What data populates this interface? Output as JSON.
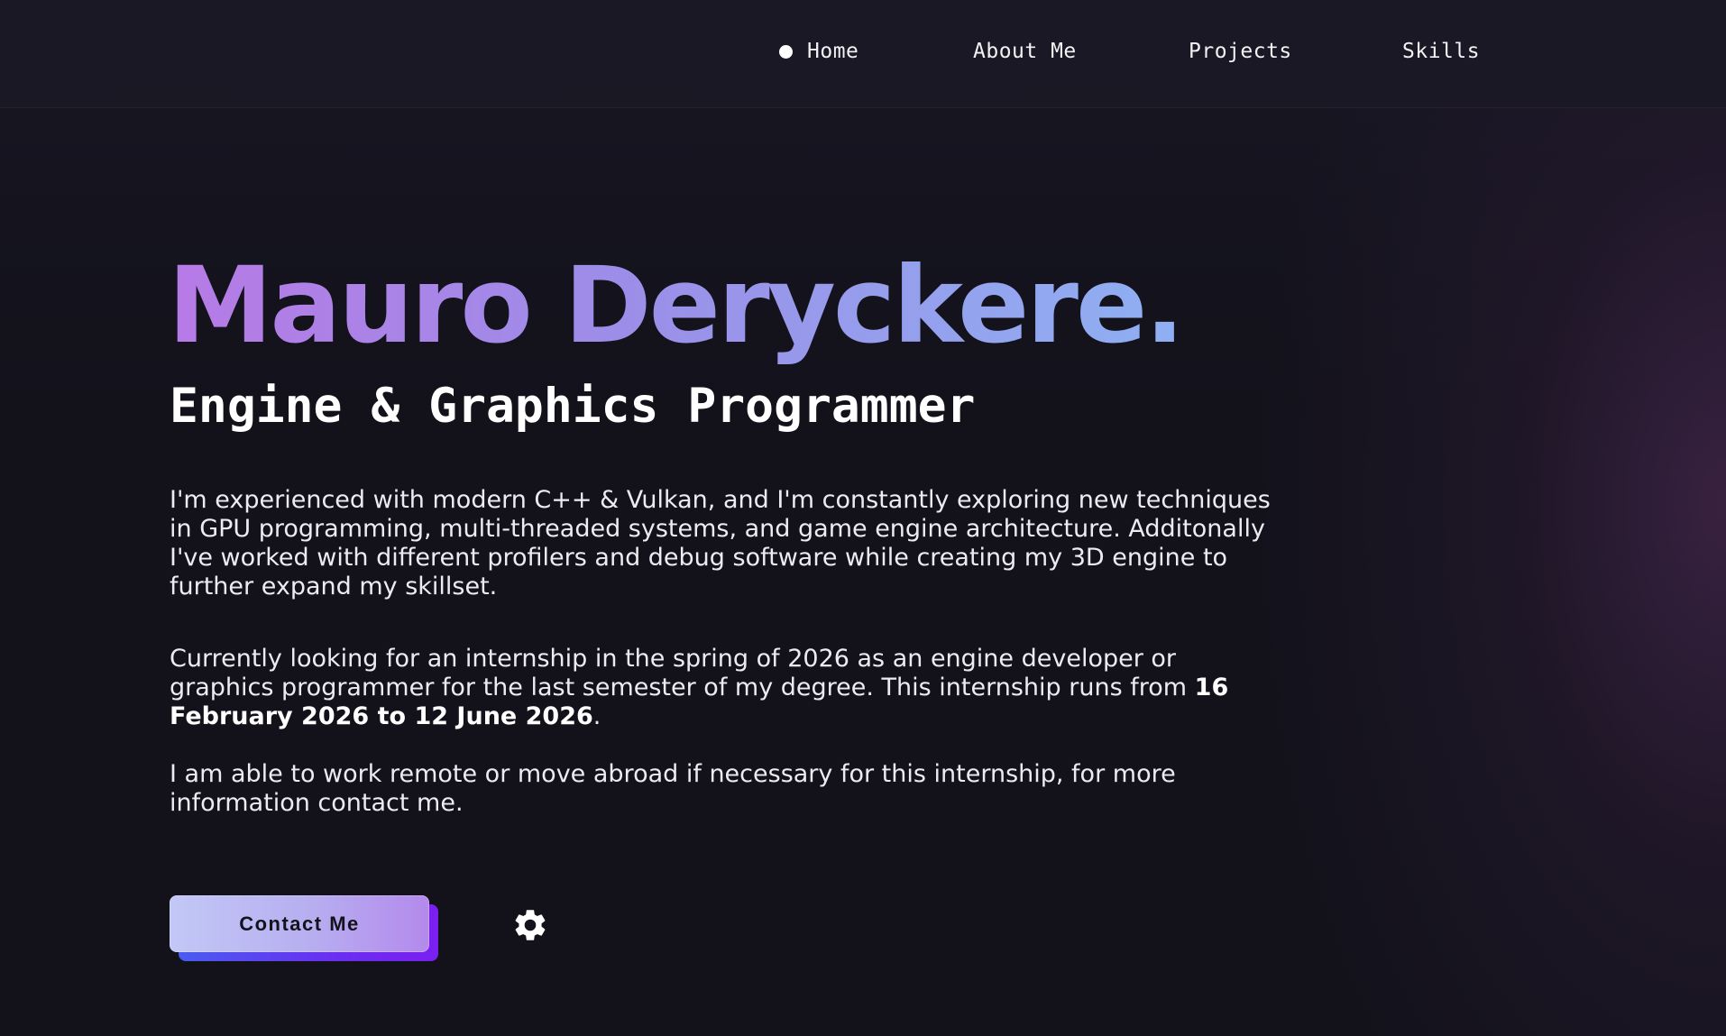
{
  "nav": {
    "items": [
      {
        "label": "Home",
        "active": true
      },
      {
        "label": "About Me",
        "active": false
      },
      {
        "label": "Projects",
        "active": false
      },
      {
        "label": "Skills",
        "active": false
      }
    ]
  },
  "hero": {
    "name": "Mauro Deryckere.",
    "role": "Engine & Graphics Programmer",
    "paragraph_1": "I'm experienced with modern C++ & Vulkan, and I'm constantly exploring new techniques in GPU programming, multi-threaded systems, and game engine architecture. Additonally I've worked with different profilers and debug software while creating my 3D engine to further expand my skillset.",
    "paragraph_2_prefix": "Currently looking for an internship in the spring of 2026 as an engine developer or graphics programmer for the last semester of my degree. This internship runs from ",
    "paragraph_2_bold": "16 February 2026 to 12 June 2026",
    "paragraph_2_suffix": ".",
    "paragraph_3": "I am able to work remote or move abroad if necessary for this internship, for more information contact me.",
    "contact_button": "Contact Me"
  },
  "icons": {
    "nav_active": "dot-icon",
    "settings": "gear-icon"
  },
  "colors": {
    "background": "#13121b",
    "name_gradient_start": "#b77ae6",
    "name_gradient_end": "#8fb0f2",
    "button_gradient_start": "#c2c8f6",
    "button_gradient_end": "#b489ec",
    "button_shadow": "#6a2ff0"
  }
}
